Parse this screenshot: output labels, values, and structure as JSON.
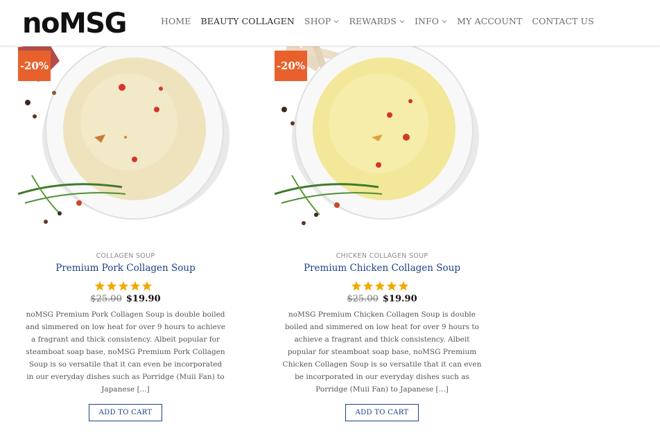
{
  "header": {
    "logo_text": "noMSG",
    "nav": [
      {
        "label": "HOME"
      },
      {
        "label": "BEAUTY COLLAGEN"
      },
      {
        "label": "SHOP"
      },
      {
        "label": "REWARDS"
      },
      {
        "label": "INFO"
      },
      {
        "label": "MY ACCOUNT"
      },
      {
        "label": "CONTACT US"
      }
    ]
  },
  "colors": {
    "accent": "#1c3f86",
    "badge": "#e8612c",
    "star": "#f2a900"
  },
  "products": [
    {
      "badge": "-20%",
      "category": "COLLAGEN SOUP",
      "title": "Premium Pork Collagen Soup",
      "rating": 5,
      "old_price": "$25.00",
      "new_price": "$19.90",
      "description": "noMSG Premium Pork Collagen Soup is double boiled and simmered on low heat for over 9 hours to achieve a fragrant and thick consistency. Albeit popular for steamboat soap base, noMSG Premium Pork Collagen Soup is so versatile that it can even be incorporated in our everyday dishes such as Porridge (Muii Fan) to Japanese [...]",
      "button": "ADD TO CART"
    },
    {
      "badge": "-20%",
      "category": "CHICKEN COLLAGEN SOUP",
      "title": "Premium Chicken Collagen Soup",
      "rating": 5,
      "old_price": "$25.00",
      "new_price": "$19.90",
      "description": "noMSG Premium Chicken Collagen Soup is double boiled and simmered on low heat for over 9 hours to achieve a fragrant and thick consistency. Albeit popular for steamboat soap base, noMSG Premium Chicken Collagen Soup is so versatile that it can even be incorporated in our everyday dishes such as Porridge (Muii Fan) to Japanese [...]",
      "button": "ADD TO CART"
    }
  ]
}
